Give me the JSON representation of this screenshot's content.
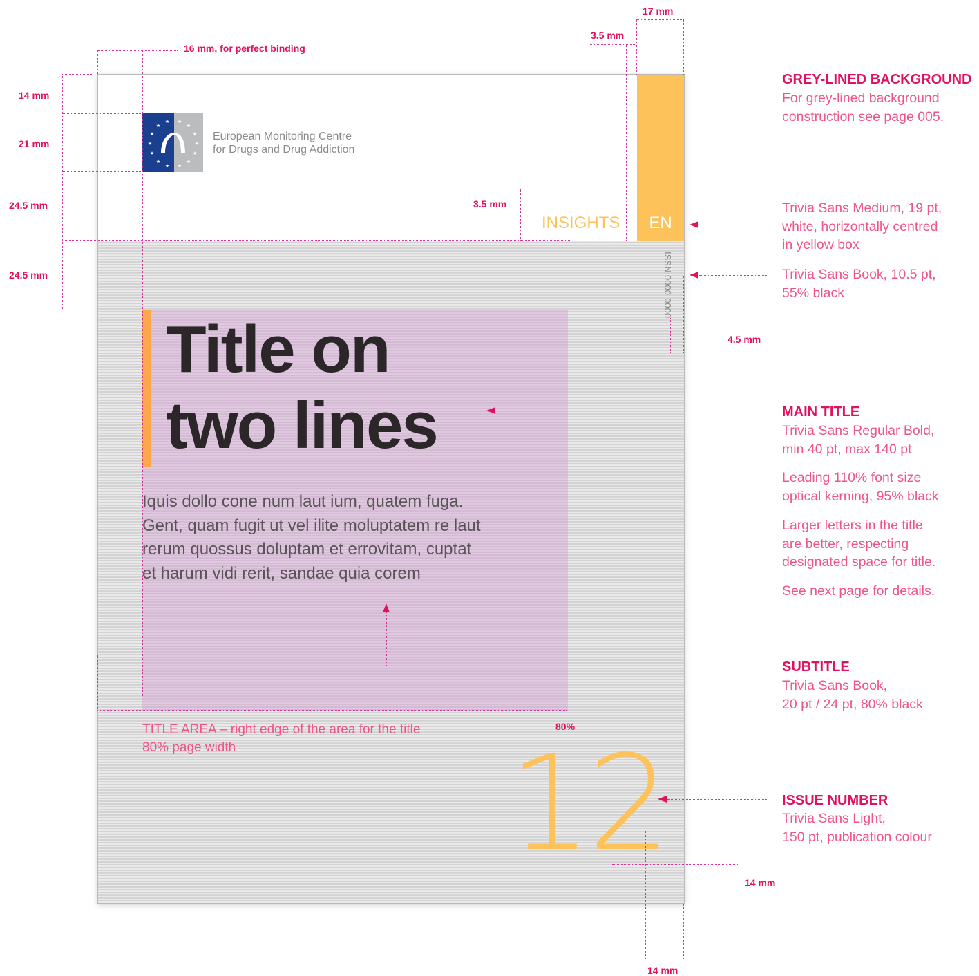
{
  "dimensions": {
    "spine_width": "17 mm",
    "spine_gap": "3.5 mm",
    "binding_margin": "16 mm, for perfect binding",
    "top_margin": "14 mm",
    "logo_height": "21 mm",
    "header_band": "24.5 mm",
    "title_offset": "24.5 mm",
    "insights_gap": "3.5 mm",
    "issn_offset": "4.5 mm",
    "title_area_width": "80%",
    "number_bottom": "14 mm",
    "number_right": "14 mm"
  },
  "cover": {
    "logo": {
      "line1": "European Monitoring Centre",
      "line2": "for Drugs and Drug Addiction"
    },
    "series_label": "INSIGHTS",
    "language_code": "EN",
    "issn": "ISSN 0000-0000",
    "title_line1": "Title on",
    "title_line2": "two lines",
    "subtitle_lines": [
      "Iquis dollo cone num laut ium, quatem fuga.",
      "Gent, quam fugit ut vel ilite moluptatem re laut",
      "rerum quossus doluptam et errovitam, cuptat",
      "et harum vidi rerit, sandae quia corem"
    ],
    "title_area_note_line1": "TITLE AREA – right edge of the area for the title",
    "title_area_note_line2": "80% page width",
    "issue_number": "12"
  },
  "annotations": {
    "grey_background": {
      "heading": "GREY-LINED BACKGROUND",
      "lines": [
        "For grey-lined background",
        "construction see page 005."
      ]
    },
    "language_code": {
      "lines": [
        "Trivia Sans Medium, 19 pt,",
        "white, horizontally centred",
        "in yellow box"
      ]
    },
    "issn": {
      "lines": [
        "Trivia Sans Book, 10.5 pt,",
        "55% black"
      ]
    },
    "main_title": {
      "heading": "MAIN TITLE",
      "lines": [
        "Trivia Sans Regular Bold,",
        "min 40 pt, max 140 pt"
      ],
      "leading_lines": [
        "Leading 110% font size",
        "optical kerning, 95% black"
      ],
      "advice_lines": [
        "Larger letters in the title",
        "are better, respecting",
        "designated space for title."
      ],
      "see_next": "See next page for details."
    },
    "subtitle": {
      "heading": "SUBTITLE",
      "lines": [
        "Trivia Sans Book,",
        "20 pt / 24 pt, 80% black"
      ]
    },
    "issue_number": {
      "heading": "ISSUE NUMBER",
      "lines": [
        "Trivia Sans Light,",
        "150 pt, publication colour"
      ]
    }
  },
  "colors": {
    "annotation_accent": "#e0115f",
    "annotation_text": "#ef5588",
    "publication_yellow": "#fdc35a",
    "title_accent_orange": "#fba84d",
    "eu_blue": "#1b3f8f",
    "logo_grey": "#bbbcbe",
    "title_black": "#2b2627",
    "subtitle_grey": "#5a5357"
  }
}
